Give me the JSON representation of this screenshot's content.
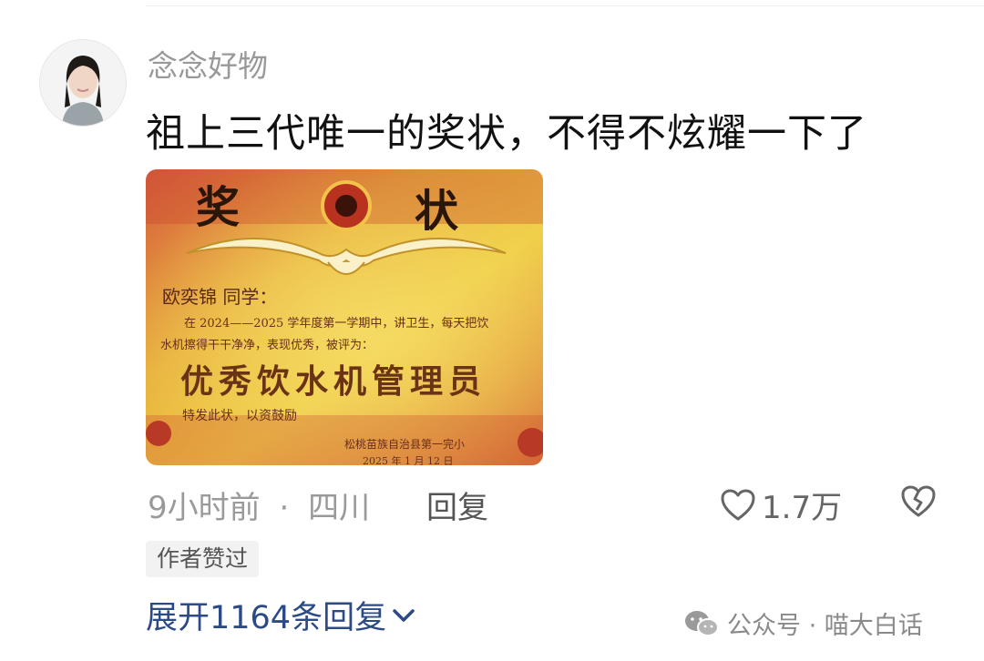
{
  "user": {
    "name": "念念好物"
  },
  "comment": {
    "text": "祖上三代唯一的奖状，不得不炫耀一下了"
  },
  "certificate": {
    "title_left": "奖",
    "title_right": "状",
    "recipient": "欧奕锦  同学：",
    "line1": "在 2024——2025 学年度第一学期中，讲卫生，每天把饮",
    "line2": "水机擦得干干净净，表现优秀，被评为：",
    "award": "优秀饮水机管理员",
    "closing": "特发此状，以资鼓励",
    "issuer": "松桃苗族自治县第一完小",
    "date": "2025 年 1 月 12 日"
  },
  "meta": {
    "time": "9小时前",
    "separator": "·",
    "location": "四川",
    "reply_label": "回复"
  },
  "likes": {
    "count": "1.7万"
  },
  "badge": {
    "author_liked": "作者赞过"
  },
  "expand": {
    "label": "展开1164条回复"
  },
  "watermark": {
    "text": "公众号 · 喵大白话"
  },
  "colors": {
    "link": "#2b4a86",
    "muted": "#9a9a9a",
    "paper_red": "#c0412f",
    "paper_gold": "#e9c23a"
  }
}
